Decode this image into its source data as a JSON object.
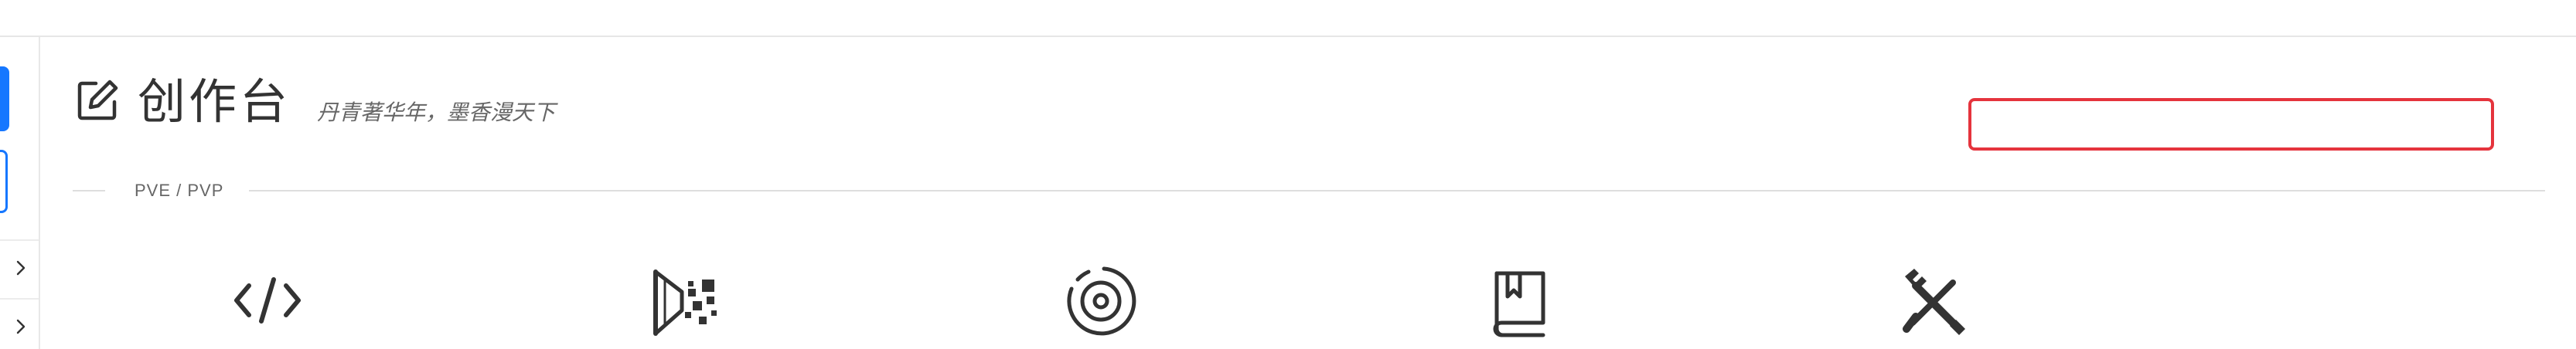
{
  "header": {
    "title": "创作台",
    "subtitle": "丹青著华年，墨香漫天下",
    "icon": "edit-square-icon"
  },
  "search": {
    "value": "",
    "placeholder": "",
    "border_color": "#e5343d"
  },
  "section": {
    "label": "PVE / PVP"
  },
  "left_rail": {
    "items": [
      "primary-block",
      "outline-block",
      "chevron-right-icon",
      "chevron-right-icon"
    ],
    "accent": "#1677ff"
  },
  "tools": [
    {
      "icon": "code-icon"
    },
    {
      "icon": "stage-effects-icon"
    },
    {
      "icon": "disc-icon"
    },
    {
      "icon": "book-icon"
    },
    {
      "icon": "tools-icon"
    }
  ]
}
